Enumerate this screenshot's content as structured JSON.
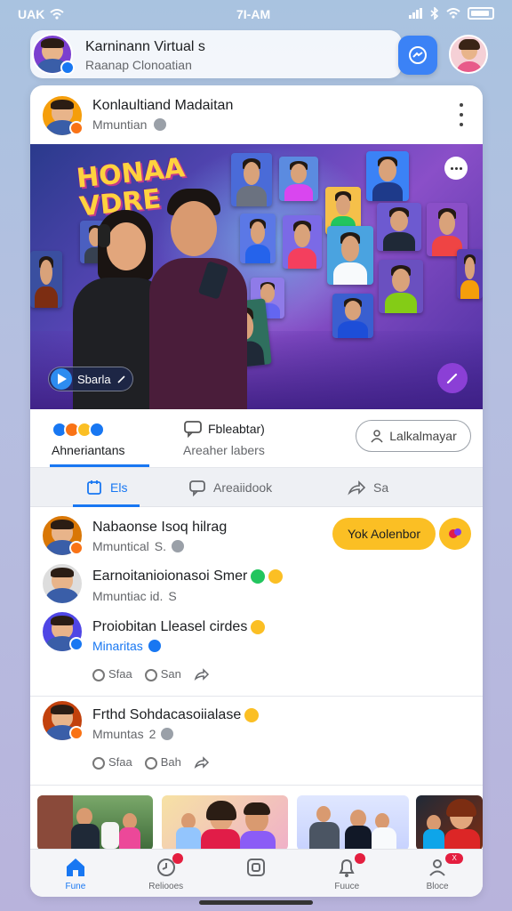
{
  "status_bar": {
    "carrier": "UAK",
    "time": "7I-AM"
  },
  "top_bar": {
    "title": "Karninann Virtual s",
    "subtitle": "Raanap Clonoatian"
  },
  "post": {
    "author": "Konlaultiand Madaitan",
    "meta": "Mmuntian",
    "hero": {
      "logo_line1": "HONAA",
      "logo_line2": "VDRE",
      "play_label": "Sbarla"
    },
    "reactions": {
      "label": "Ahneriantans"
    },
    "comments_summary": {
      "title": "Fbleabtar)",
      "subtitle": "Areaher labers"
    },
    "outline_button": "Lalkalmayar"
  },
  "tabs": [
    {
      "label": "Els"
    },
    {
      "label": "Areaiidook"
    },
    {
      "label": "Sa"
    }
  ],
  "comments": [
    {
      "name": "Nabaonse Isoq hilrag",
      "meta": "Mmuntical",
      "meta_extra": "S.",
      "reply_button": "Yok Aolenbor"
    },
    {
      "name": "Earnoitanioionasoi Smer",
      "meta": "Mmuntiac id.",
      "meta_extra": "S"
    },
    {
      "name": "Proiobitan Lleasel cirdes",
      "meta": "Minaritas",
      "actions": [
        "Sfaa",
        "San"
      ]
    },
    {
      "name": "Frthd Sohdacasoiialase",
      "meta": "Mmuntas",
      "meta_extra": "2",
      "actions": [
        "Sfaa",
        "Bah"
      ]
    }
  ],
  "bottom_nav": [
    {
      "label": "Fune",
      "icon": "home-icon",
      "active": true
    },
    {
      "label": "Reliooes",
      "icon": "clock-icon",
      "badge": true
    },
    {
      "label": "",
      "icon": "square-icon"
    },
    {
      "label": "Fuuce",
      "icon": "bell-icon",
      "badge": true
    },
    {
      "label": "Bloce",
      "icon": "profile-icon",
      "badge_text": "X"
    }
  ],
  "colors": {
    "accent": "#1877f2",
    "yellow": "#fbbf24",
    "purple": "#8b3fd6"
  }
}
